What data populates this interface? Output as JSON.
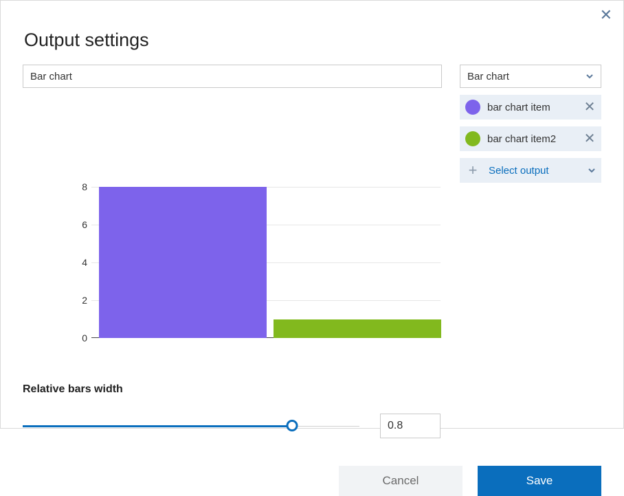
{
  "dialog": {
    "title": "Output settings",
    "name_value": "Bar chart"
  },
  "type_select": {
    "value": "Bar chart"
  },
  "items": [
    {
      "label": "bar chart item",
      "color": "#7d63eb"
    },
    {
      "label": "bar chart item2",
      "color": "#82b91e"
    }
  ],
  "add_output_label": "Select output",
  "width": {
    "label": "Relative bars width",
    "value": "0.8",
    "fraction": 0.8
  },
  "buttons": {
    "cancel": "Cancel",
    "save": "Save"
  },
  "chart_data": {
    "type": "bar",
    "categories": [
      "bar chart item",
      "bar chart item2"
    ],
    "values": [
      8,
      1
    ],
    "colors": [
      "#7d63eb",
      "#82b91e"
    ],
    "ylim": [
      0,
      8
    ],
    "yticks": [
      0,
      2,
      4,
      6,
      8
    ],
    "title": "",
    "xlabel": "",
    "ylabel": ""
  }
}
